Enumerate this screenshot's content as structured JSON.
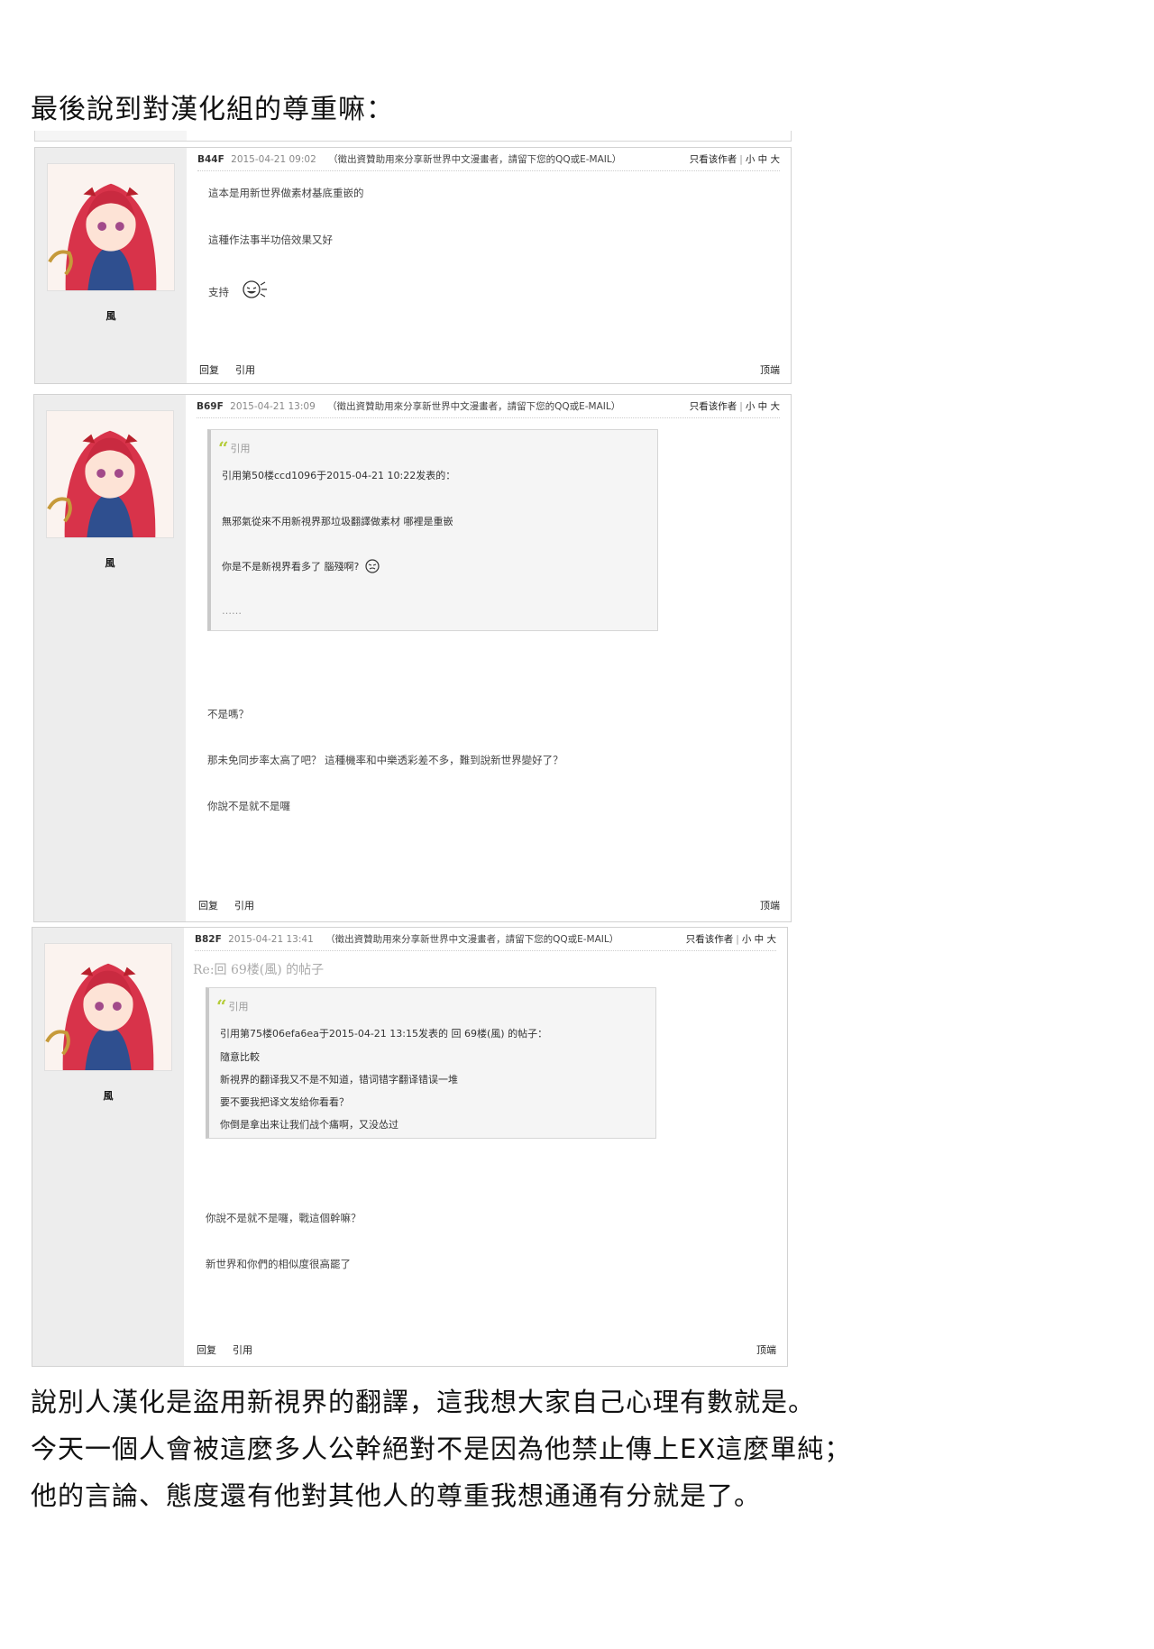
{
  "heading": "最後說到對漢化組的尊重嘛：",
  "posts": [
    {
      "floor": "B44F",
      "date": "2015-04-21 09:02",
      "notice": "（徵出資贊助用來分享新世界中文漫畫者，請留下您的QQ或E-MAIL）",
      "username": "風",
      "lines": [
        "這本是用新世界做素材基底重嵌的",
        "這種作法事半功倍效果又好",
        "支持"
      ],
      "emote": "laughing-face-icon"
    },
    {
      "floor": "B69F",
      "date": "2015-04-21 13:09",
      "notice": "（徵出資贊助用來分享新世界中文漫畫者，請留下您的QQ或E-MAIL）",
      "username": "風",
      "quote": {
        "label": "引用",
        "lines": [
          "引用第50楼ccd1096于2015-04-21 10:22发表的：",
          "無邪氣從來不用新視界那垃圾翻譯做素材 哪裡是重嵌",
          "你是不是新視界看多了 腦殘啊?",
          "……"
        ]
      },
      "lines": [
        "不是嗎？",
        "那未免同步率太高了吧？  這種機率和中樂透彩差不多，難到說新世界變好了？",
        "你說不是就不是囉"
      ]
    },
    {
      "floor": "B82F",
      "date": "2015-04-21 13:41",
      "notice": "（徵出資贊助用來分享新世界中文漫畫者，請留下您的QQ或E-MAIL）",
      "username": "風",
      "re_title": "Re:回 69楼(風) 的帖子",
      "quote": {
        "label": "引用",
        "lines": [
          "引用第75楼06efa6ea于2015-04-21 13:15发表的 回 69楼(風) 的帖子：",
          "隨意比較",
          "新視界的翻译我又不是不知道，错词错字翻译错误一堆",
          "要不要我把译文发给你看看？",
          "你倒是拿出来让我们战个痛啊，又没怂过"
        ]
      },
      "lines": [
        "你說不是就不是囉，戰這個幹嘛？",
        "新世界和你們的相似度很高罷了"
      ]
    }
  ],
  "meta_links": {
    "only_author": "只看该作者",
    "sep": "|",
    "small": "小",
    "medium": "中",
    "large": "大"
  },
  "actions": {
    "reply": "回复",
    "quote": "引用",
    "top": "顶端"
  },
  "footer": [
    "說別人漢化是盜用新視界的翻譯，這我想大家自己心理有數就是。",
    "今天一個人會被這麼多人公幹絕對不是因為他禁止傳上EX這麼單純；",
    "他的言論、態度還有他對其他人的尊重我想通通有分就是了。"
  ]
}
